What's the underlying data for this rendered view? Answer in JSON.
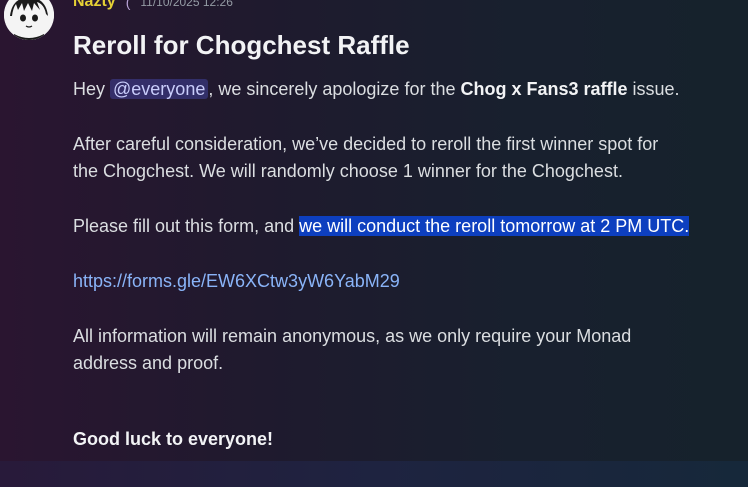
{
  "author": {
    "name": "Nazty",
    "timestamp": "11/10/2025 12:26"
  },
  "message": {
    "title": "Reroll for Chogchest Raffle",
    "p1": {
      "lead": "Hey ",
      "mention": "@everyone",
      "mid": ", we sincerely apologize for the ",
      "bold": "Chog x Fans3 raffle",
      "tail": " issue."
    },
    "p2": {
      "line1": "After careful consideration, we’ve decided to reroll the first winner spot for",
      "line2": "the Chogchest. We will randomly choose 1 winner for the Chogchest."
    },
    "p3": {
      "lead": "Please fill out this form, and ",
      "highlighted": "we will conduct the reroll tomorrow at 2 PM UTC."
    },
    "link": "https://forms.gle/EW6XCtw3yW6YabM29",
    "p4": {
      "line1": "All information will remain anonymous, as we only require your Monad",
      "line2": "address and proof."
    },
    "closing": "Good luck to everyone!"
  },
  "colors": {
    "username": "#e6d135",
    "link": "#8ab4f8",
    "selection": "#0d3fbf",
    "mention_bg": "#3a3f77"
  }
}
